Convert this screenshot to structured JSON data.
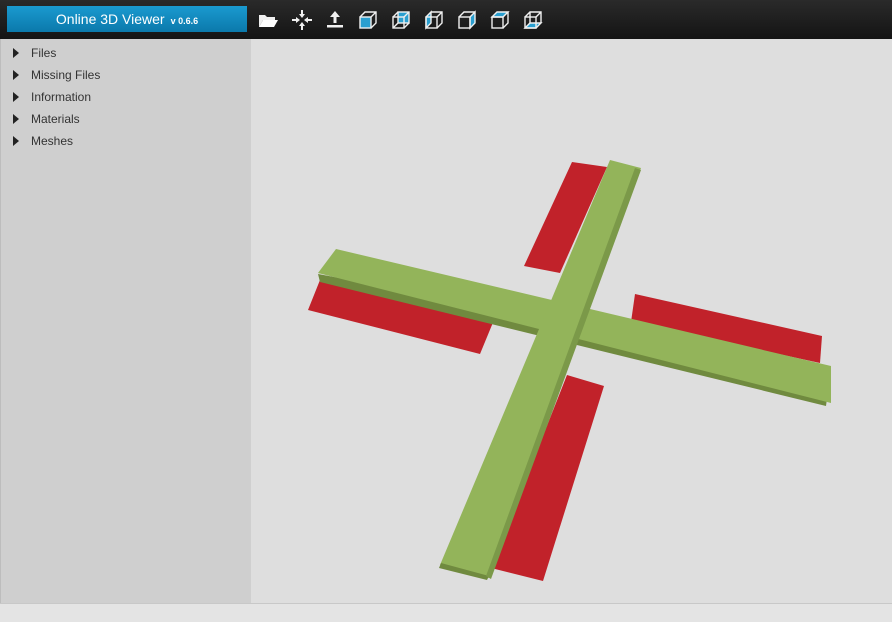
{
  "app": {
    "name": "Online 3D Viewer",
    "version": "v 0.6.6"
  },
  "toolbar": {
    "icons": [
      "open-folder-icon",
      "fit-to-window-icon",
      "set-up-vector-icon",
      "front-view-icon",
      "back-view-icon",
      "left-view-icon",
      "right-view-icon",
      "top-view-icon",
      "bottom-view-icon"
    ]
  },
  "sidebar": {
    "items": [
      {
        "label": "Files"
      },
      {
        "label": "Missing Files"
      },
      {
        "label": "Information"
      },
      {
        "label": "Materials"
      },
      {
        "label": "Meshes"
      }
    ]
  },
  "model": {
    "colors": {
      "red": "#c1222a",
      "green": "#93b45a",
      "green_dark": "#708a3f",
      "red_dark": "#8e1a20"
    }
  }
}
